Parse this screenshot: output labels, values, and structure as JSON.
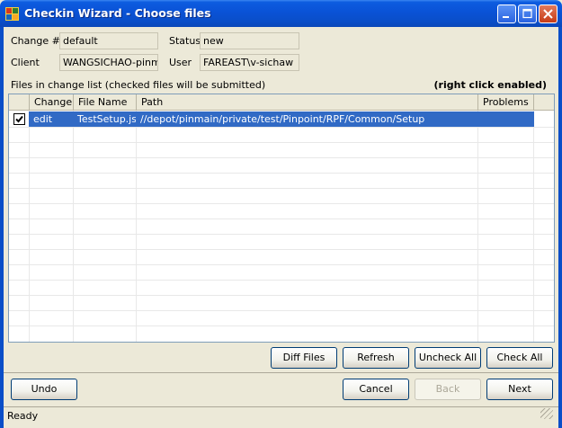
{
  "window": {
    "title": "Checkin Wizard - Choose files"
  },
  "colors": {
    "titlebar": "#0a52d6",
    "selection": "#316ac5",
    "window_bg": "#ece9d8"
  },
  "info": {
    "change_label": "Change #",
    "change_value": "default",
    "status_label": "Status",
    "status_value": "new",
    "client_label": "Client",
    "client_value": "WANGSICHAO-pinma",
    "user_label": "User",
    "user_value": "FAREAST\\v-sichaw"
  },
  "files": {
    "caption": "Files in change list (checked files will be submitted)",
    "hint": "(right click enabled)",
    "columns": [
      "Change",
      "File Name",
      "Path",
      "Problems"
    ],
    "rows": [
      {
        "checked": true,
        "change": "edit",
        "file_name": "TestSetup.js",
        "path": "//depot/pinmain/private/test/Pinpoint/RPF/Common/Setup",
        "problems": ""
      }
    ]
  },
  "list_buttons": {
    "diff": "Diff Files",
    "refresh": "Refresh",
    "uncheck_all": "Uncheck All",
    "check_all": "Check All"
  },
  "nav_buttons": {
    "undo": "Undo",
    "cancel": "Cancel",
    "back": "Back",
    "next": "Next"
  },
  "status_bar": {
    "text": "Ready"
  }
}
